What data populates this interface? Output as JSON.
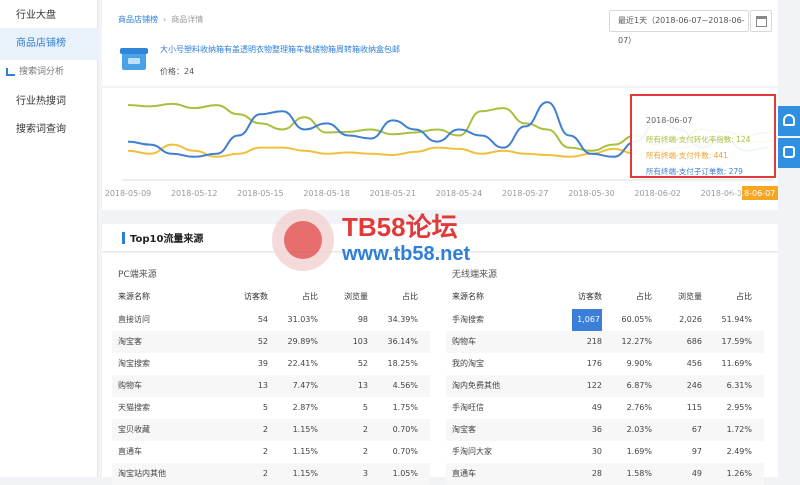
{
  "sidebar": {
    "items": [
      {
        "label": "行业大盘",
        "active": false
      },
      {
        "label": "商品店铺榜",
        "active": true
      }
    ],
    "group_label": "搜索词分析",
    "sub_items": [
      {
        "label": "行业热搜词"
      },
      {
        "label": "搜索词查询"
      }
    ]
  },
  "breadcrumb": {
    "first": "商品店铺榜",
    "separator": "›",
    "second": "商品详情"
  },
  "date_range": "最近1天（2018-06-07~2018-06-07）",
  "product": {
    "title": "大小号塑料收纳箱有盖透明衣物整理箱车载储物箱周转箱收纳盒包邮",
    "price_label": "价格：24"
  },
  "chart_data": {
    "type": "line",
    "x": [
      "2018-05-09",
      "2018-05-10",
      "2018-05-11",
      "2018-05-12",
      "2018-05-13",
      "2018-05-14",
      "2018-05-15",
      "2018-05-16",
      "2018-05-17",
      "2018-05-18",
      "2018-05-19",
      "2018-05-20",
      "2018-05-21",
      "2018-05-22",
      "2018-05-23",
      "2018-05-24",
      "2018-05-25",
      "2018-05-26",
      "2018-05-27",
      "2018-05-28",
      "2018-05-29",
      "2018-05-30",
      "2018-05-31",
      "2018-06-01",
      "2018-06-02",
      "2018-06-03",
      "2018-06-04",
      "2018-06-05",
      "2018-06-06",
      "2018-06-07"
    ],
    "tick_labels": [
      "2018-05-09",
      "2018-05-12",
      "2018-05-15",
      "2018-05-18",
      "2018-05-21",
      "2018-05-24",
      "2018-05-27",
      "2018-05-30",
      "2018-06-02",
      "2018-06-05",
      "2018-06-07"
    ],
    "series": [
      {
        "name": "所有终端-支付转化率指数",
        "color": "#a9bf3e",
        "values": [
          110,
          108,
          112,
          105,
          110,
          95,
          80,
          70,
          90,
          65,
          66,
          70,
          62,
          65,
          70,
          60,
          100,
          105,
          80,
          70,
          40,
          35,
          45,
          60,
          45,
          55,
          70,
          66,
          60,
          65
        ]
      },
      {
        "name": "所有终端-支付件数",
        "color": "#f0c03d",
        "values": [
          35,
          30,
          45,
          35,
          25,
          30,
          40,
          40,
          35,
          30,
          32,
          30,
          28,
          33,
          40,
          38,
          30,
          35,
          30,
          28,
          25,
          30,
          38,
          30,
          35,
          40,
          45,
          55,
          50,
          50
        ]
      },
      {
        "name": "所有终端-支付子订单数",
        "color": "#3f7fd0",
        "values": [
          50,
          45,
          30,
          25,
          30,
          60,
          95,
          100,
          70,
          80,
          60,
          55,
          85,
          70,
          50,
          70,
          60,
          40,
          75,
          115,
          60,
          30,
          25,
          50,
          85,
          70,
          40,
          55,
          35,
          40
        ]
      }
    ],
    "ylim": [
      0,
      125
    ],
    "tooltip": {
      "date": "2018-06-07",
      "lines": [
        {
          "text": "所有终端-支付转化率指数: 124",
          "color": "#a9bf3e"
        },
        {
          "text": "所有终端-支付件数: 441",
          "color": "#f0a030"
        },
        {
          "text": "所有终端-支付子订单数: 279",
          "color": "#3f7fd0"
        }
      ]
    },
    "active_tick": "2018-06-07"
  },
  "section": {
    "title": "Top10流量来源"
  },
  "pc_table": {
    "title": "PC端来源",
    "headers": [
      "来源名称",
      "访客数",
      "占比",
      "浏览量",
      "占比"
    ],
    "rows": [
      [
        "直接访问",
        "54",
        "31.03%",
        "98",
        "34.39%"
      ],
      [
        "淘宝客",
        "52",
        "29.89%",
        "103",
        "36.14%"
      ],
      [
        "淘宝搜索",
        "39",
        "22.41%",
        "52",
        "18.25%"
      ],
      [
        "购物车",
        "13",
        "7.47%",
        "13",
        "4.56%"
      ],
      [
        "天猫搜索",
        "5",
        "2.87%",
        "5",
        "1.75%"
      ],
      [
        "宝贝收藏",
        "2",
        "1.15%",
        "2",
        "0.70%"
      ],
      [
        "直通车",
        "2",
        "1.15%",
        "2",
        "0.70%"
      ],
      [
        "淘宝站内其他",
        "2",
        "1.15%",
        "3",
        "1.05%"
      ]
    ]
  },
  "mobile_table": {
    "title": "无线端来源",
    "headers": [
      "来源名称",
      "访客数",
      "占比",
      "浏览量",
      "占比"
    ],
    "rows": [
      [
        "手淘搜索",
        "1,067",
        "60.05%",
        "2,026",
        "51.94%"
      ],
      [
        "购物车",
        "218",
        "12.27%",
        "686",
        "17.59%"
      ],
      [
        "我的淘宝",
        "176",
        "9.90%",
        "456",
        "11.69%"
      ],
      [
        "淘内免费其他",
        "122",
        "6.87%",
        "246",
        "6.31%"
      ],
      [
        "手淘旺信",
        "49",
        "2.76%",
        "115",
        "2.95%"
      ],
      [
        "淘宝客",
        "36",
        "2.03%",
        "67",
        "1.72%"
      ],
      [
        "手淘问大家",
        "30",
        "1.69%",
        "97",
        "2.49%"
      ],
      [
        "直通车",
        "28",
        "1.58%",
        "49",
        "1.26%"
      ]
    ]
  },
  "watermark": {
    "line1": "TB58论坛",
    "line2": "www.tb58.net"
  }
}
